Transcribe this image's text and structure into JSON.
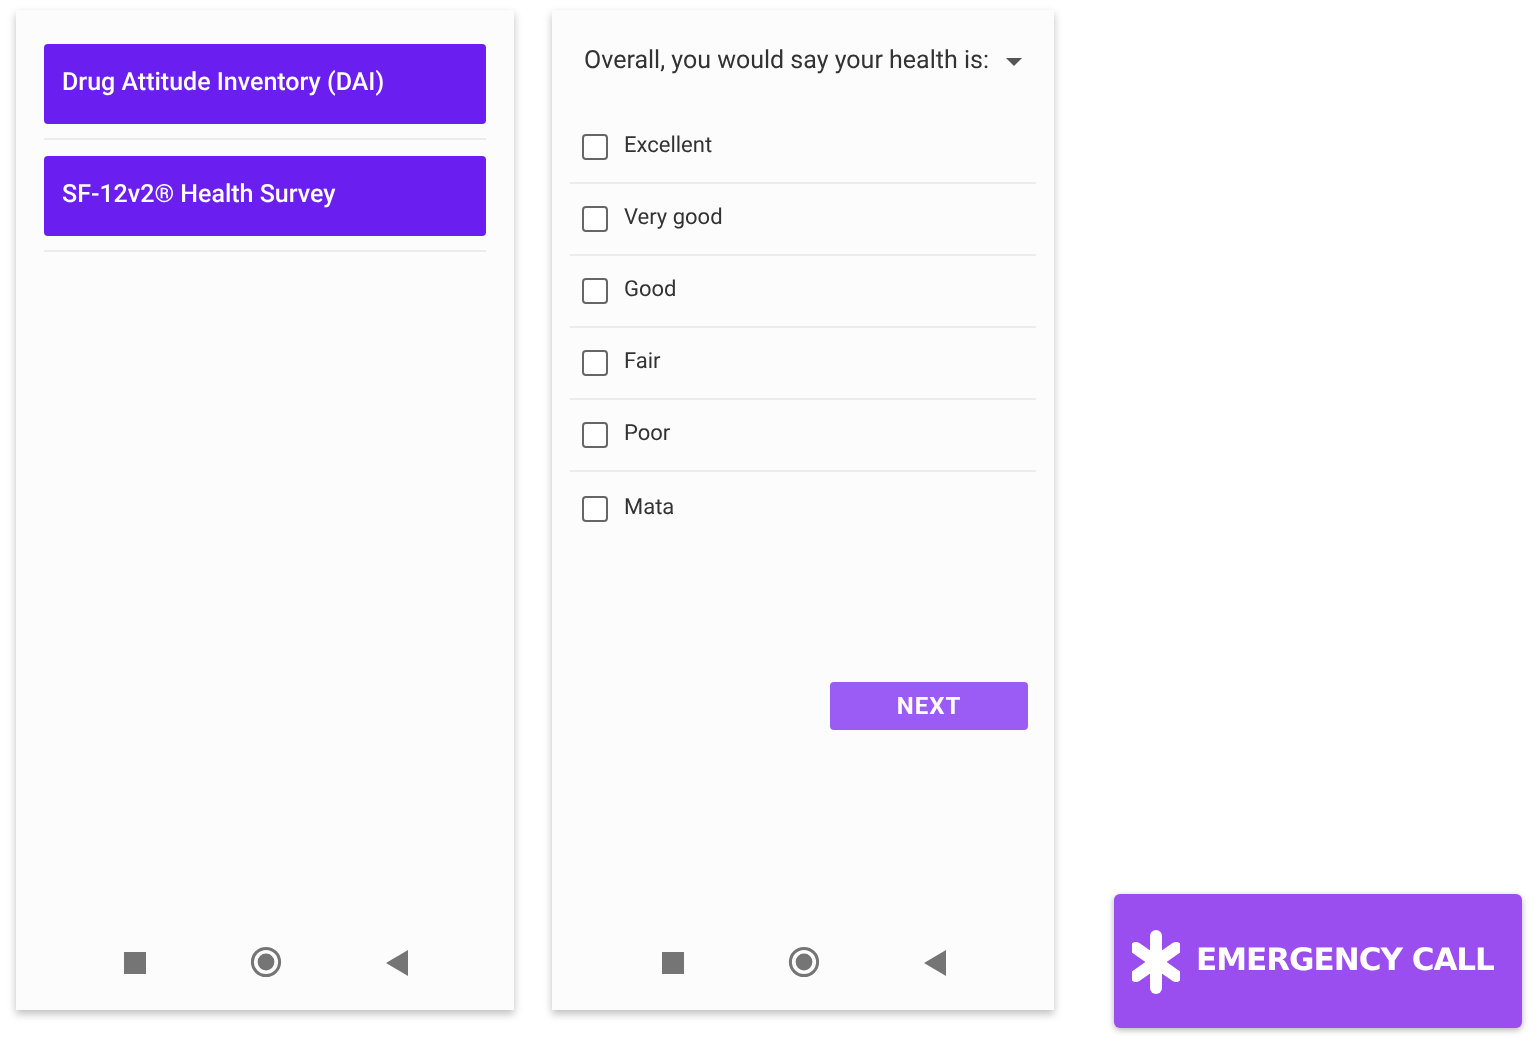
{
  "survey_list": {
    "items": [
      {
        "label": "Drug Attitude Inventory (DAI)"
      },
      {
        "label": "SF-12v2® Health Survey"
      }
    ]
  },
  "question": {
    "prompt": "Overall, you would say your health is:",
    "options": [
      {
        "label": "Excellent",
        "checked": false
      },
      {
        "label": "Very good",
        "checked": false
      },
      {
        "label": "Good",
        "checked": false
      },
      {
        "label": "Fair",
        "checked": false
      },
      {
        "label": "Poor",
        "checked": false
      },
      {
        "label": "Mata",
        "checked": false
      }
    ],
    "next_button": "NEXT"
  },
  "emergency_button": "EMERGENCY CALL"
}
